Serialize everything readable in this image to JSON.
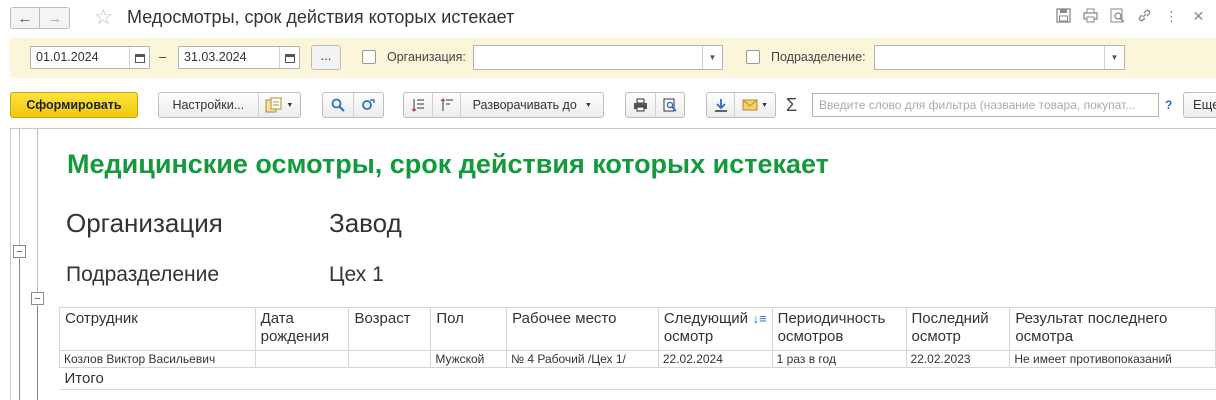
{
  "window": {
    "title": "Медосмотры, срок действия которых истекает"
  },
  "filters": {
    "date_from": "01.01.2024",
    "date_to": "31.03.2024",
    "dash": "–",
    "period_button": "...",
    "organization_label": "Организация:",
    "organization_value": "",
    "department_label": "Подразделение:",
    "department_value": ""
  },
  "toolbar": {
    "generate_label": "Сформировать",
    "settings_label": "Настройки...",
    "expand_label": "Разворачивать до",
    "search_placeholder": "Введите слово для фильтра (название товара, покупат...",
    "help_label": "?",
    "more_label": "Еще",
    "sum_symbol": "Σ"
  },
  "report": {
    "title": "Медицинские осмотры, срок действия которых истекает",
    "organization_label": "Организация",
    "organization_value": "Завод",
    "department_label": "Подразделение",
    "department_value": "Цех 1",
    "columns": [
      "Сотрудник",
      "Дата рождения",
      "Возраст",
      "Пол",
      "Рабочее место",
      "Следующий осмотр",
      "Периодичность осмотров",
      "Последний осмотр",
      "Результат последнего осмотра"
    ],
    "rows": [
      {
        "employee": "Козлов Виктор Васильевич",
        "birth_date": "",
        "age": "",
        "sex": "Мужской",
        "workplace": "№ 4 Рабочий /Цех 1/",
        "next_exam": "22.02.2024",
        "periodicity": "1 раз в год",
        "last_exam": "22.02.2023",
        "result": "Не имеет противопоказаний"
      }
    ],
    "total_label": "Итого"
  },
  "colors": {
    "title_green": "#139a3c",
    "filter_bg": "#fbf5da",
    "primary_button": "#f2c80c"
  }
}
